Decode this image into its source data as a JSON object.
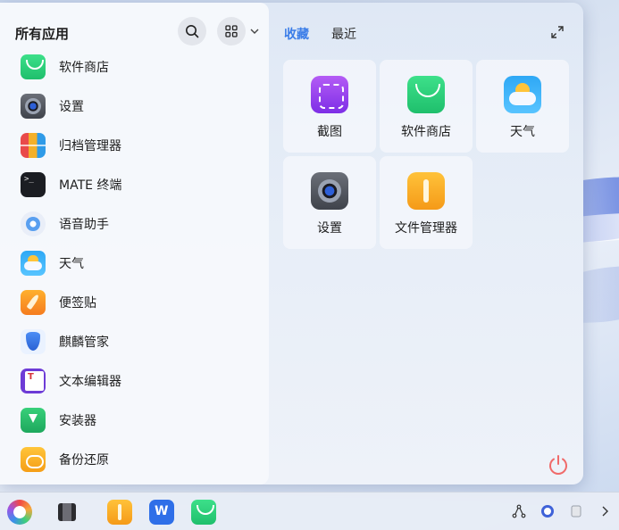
{
  "menu": {
    "title": "所有应用",
    "tabs": [
      {
        "label": "收藏",
        "active": true
      },
      {
        "label": "最近",
        "active": false
      }
    ],
    "apps": [
      {
        "label": "软件商店",
        "icon": "software-store-icon"
      },
      {
        "label": "设置",
        "icon": "settings-icon"
      },
      {
        "label": "归档管理器",
        "icon": "archive-manager-icon"
      },
      {
        "label": "MATE 终端",
        "icon": "terminal-icon"
      },
      {
        "label": "语音助手",
        "icon": "voice-assistant-icon"
      },
      {
        "label": "天气",
        "icon": "weather-icon"
      },
      {
        "label": "便签贴",
        "icon": "sticky-notes-icon"
      },
      {
        "label": "麒麟管家",
        "icon": "kylin-manager-icon"
      },
      {
        "label": "文本编辑器",
        "icon": "text-editor-icon"
      },
      {
        "label": "安装器",
        "icon": "installer-icon"
      },
      {
        "label": "备份还原",
        "icon": "backup-restore-icon"
      }
    ],
    "favorites": [
      {
        "label": "截图",
        "icon": "screenshot-icon"
      },
      {
        "label": "软件商店",
        "icon": "software-store-icon"
      },
      {
        "label": "天气",
        "icon": "weather-icon"
      },
      {
        "label": "设置",
        "icon": "settings-icon"
      },
      {
        "label": "文件管理器",
        "icon": "file-manager-icon"
      }
    ]
  },
  "taskbar": {
    "items": [
      "start-menu-icon",
      "multitask-view-icon",
      "file-manager-icon",
      "wps-office-icon",
      "software-store-icon"
    ],
    "tray": [
      "network-icon",
      "input-method-icon",
      "notification-icon",
      "tray-expand-icon"
    ]
  },
  "colors": {
    "accent": "#3b7de8",
    "power": "#f06a6a"
  }
}
